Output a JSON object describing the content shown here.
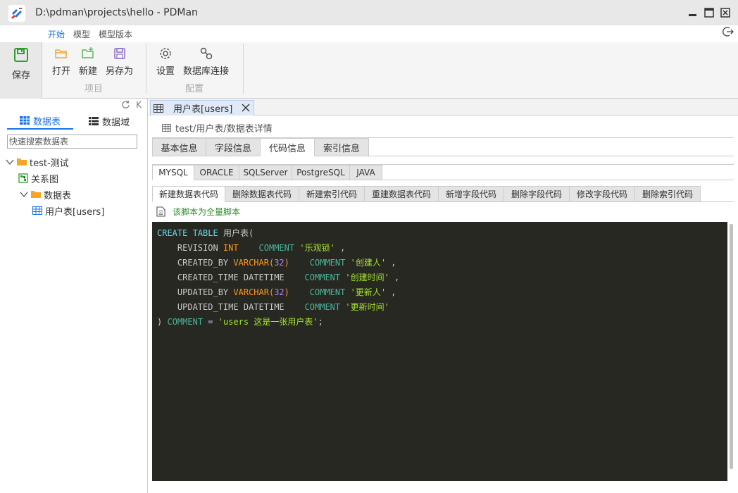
{
  "window": {
    "title": "D:\\pdman\\projects\\hello - PDMan"
  },
  "menu": {
    "tabs": [
      "开始",
      "模型",
      "模型版本"
    ],
    "active": "开始"
  },
  "ribbon": {
    "save_label": "保存",
    "group_project": {
      "label": "项目",
      "buttons": [
        "打开",
        "新建",
        "另存为"
      ]
    },
    "group_config": {
      "label": "配置",
      "buttons": [
        "设置",
        "数据库连接"
      ]
    }
  },
  "sidebar": {
    "tabs": [
      "数据表",
      "数据域"
    ],
    "active_tab": "数据表",
    "top_icons": [
      "refresh-icon",
      "collapse-icon"
    ],
    "collapse_label": "K",
    "search_placeholder": "快速搜索数据表",
    "tree": [
      {
        "label": "test-测试",
        "type": "folder",
        "expanded": true
      },
      {
        "label": "关系图",
        "type": "diagram"
      },
      {
        "label": "数据表",
        "type": "folder",
        "expanded": true
      },
      {
        "label": "用户表[users]",
        "type": "table"
      }
    ]
  },
  "editor_tab": {
    "label": "用户表[users]"
  },
  "breadcrumb": "test/用户表/数据表详情",
  "detail_tabs": {
    "items": [
      "基本信息",
      "字段信息",
      "代码信息",
      "索引信息"
    ],
    "active": "代码信息"
  },
  "db_tabs": {
    "items": [
      "MYSQL",
      "ORACLE",
      "SQLServer",
      "PostgreSQL",
      "JAVA"
    ],
    "active": "MYSQL"
  },
  "code_tabs": {
    "items": [
      "新建数据表代码",
      "删除数据表代码",
      "新建索引代码",
      "重建数据表代码",
      "新增字段代码",
      "删除字段代码",
      "修改字段代码",
      "删除索引代码"
    ],
    "active": "新建数据表代码"
  },
  "note": "该脚本为全量脚本",
  "code": {
    "line1": {
      "kw1": "CREATE",
      "kw2": "TABLE",
      "name": "用户表("
    },
    "fields": [
      {
        "name": "REVISION",
        "type": "INT",
        "len": "",
        "gap": "    ",
        "comment_kw": "COMMENT",
        "comment": "'乐观锁'",
        "tail": " ,"
      },
      {
        "name": "CREATED_BY",
        "type": "VARCHAR(",
        "len": "32",
        "gap": "    ",
        "comment_kw": "COMMENT",
        "comment": "'创建人'",
        "tail": " ,"
      },
      {
        "name": "CREATED_TIME",
        "type": "DATETIME",
        "len": "",
        "gap": "    ",
        "comment_kw": "COMMENT",
        "comment": "'创建时间'",
        "tail": " ,"
      },
      {
        "name": "UPDATED_BY",
        "type": "VARCHAR(",
        "len": "32",
        "gap": "    ",
        "comment_kw": "COMMENT",
        "comment": "'更新人'",
        "tail": " ,"
      },
      {
        "name": "UPDATED_TIME",
        "type": "DATETIME",
        "len": "",
        "gap": "    ",
        "comment_kw": "COMMENT",
        "comment": "'更新时间'",
        "tail": ""
      }
    ],
    "last": {
      "paren": ")",
      "kw": "COMMENT",
      "eq": "=",
      "str": "'users 这是一张用户表'",
      "end": ";"
    }
  },
  "colors": {
    "accent": "#1a73e8",
    "editor_bg": "#272822",
    "keyword": "#66d9ef",
    "type": "#fd971f",
    "string": "#a6e22e",
    "note": "#2e8b2e"
  }
}
